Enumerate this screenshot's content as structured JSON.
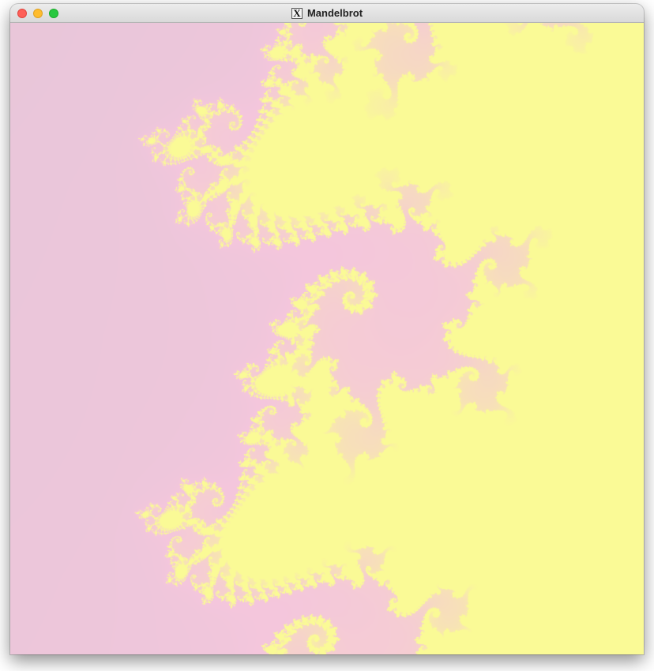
{
  "window": {
    "title": "Mandelbrot",
    "app_icon_glyph": "X",
    "controls": [
      "close-button",
      "minimize-button",
      "zoom-button"
    ]
  },
  "render": {
    "colors": {
      "background": "#bcc5cf",
      "glow": "#f4c6dc",
      "set_fill": "#fafa96",
      "titlebar_close": "#fe5f57",
      "titlebar_minimize": "#febc2e",
      "titlebar_zoom": "#28c840"
    }
  }
}
